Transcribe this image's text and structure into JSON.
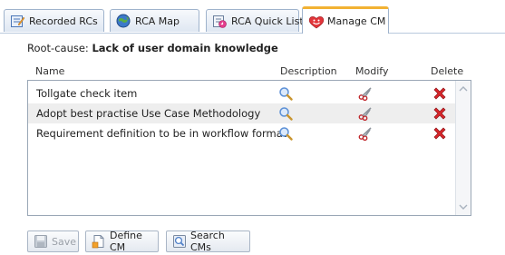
{
  "tabs": [
    {
      "label": "Recorded RCs",
      "icon": "edit-form-icon",
      "active": false
    },
    {
      "label": "RCA Map",
      "icon": "globe-map-icon",
      "active": false
    },
    {
      "label": "RCA Quick List",
      "icon": "quick-list-icon",
      "active": false
    },
    {
      "label": "Manage CM",
      "icon": "smiley-heart-icon",
      "active": true
    }
  ],
  "root_cause": {
    "label": "Root-cause:",
    "value": "Lack of user domain knowledge"
  },
  "columns": {
    "name": "Name",
    "description": "Description",
    "modify": "Modify",
    "delete": "Delete"
  },
  "rows": [
    {
      "name": "Tollgate check item"
    },
    {
      "name": "Adopt best practise Use Case Methodology"
    },
    {
      "name": "Requirement definition to be in workflow format"
    }
  ],
  "buttons": {
    "save": "Save",
    "define": "Define CM",
    "search": "Search CMs"
  },
  "colors": {
    "active_tab_accent": "#f2b233",
    "delete_red": "#d8262b",
    "magnifier_blue": "#5b8fd6"
  }
}
